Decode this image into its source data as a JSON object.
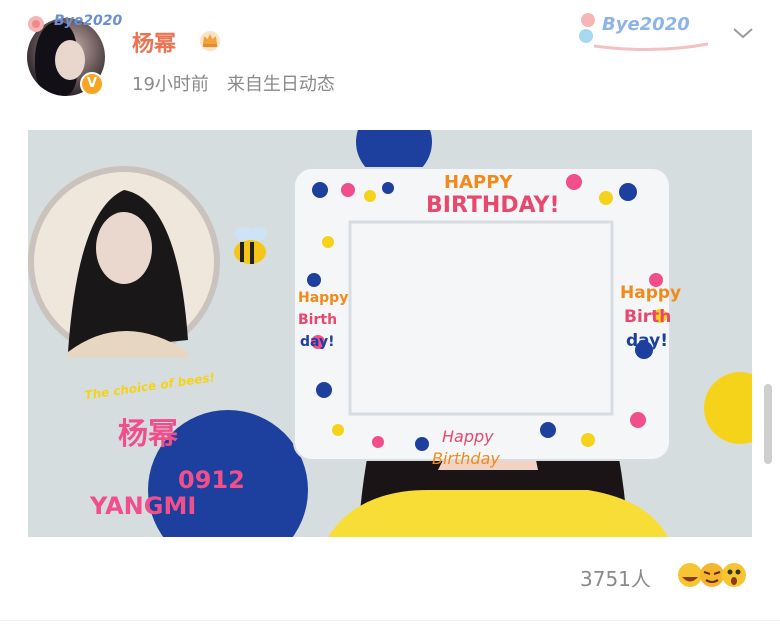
{
  "post": {
    "username": "杨幂",
    "time": "19小时前",
    "source": "来自生日动态",
    "avatar_pendant_text": "Bye2020",
    "card_text": "Bye2020"
  },
  "photo": {
    "frame_top_text_1": "HAPPY",
    "frame_top_text_2": "BIRTHDAY!",
    "frame_side_text_1": "Happy",
    "frame_side_text_2": "Birth",
    "frame_side_text_3": "day!",
    "frame_bottom_text_1": "Happy",
    "frame_bottom_text_2": "Birthday",
    "name_cn": "杨幂",
    "date": "0912",
    "name_en": "YANGMI",
    "caption": "The choice of bees!"
  },
  "footer": {
    "likes": "3751人"
  },
  "colors": {
    "username": "#eb7350",
    "verified": "#f6a623",
    "meta": "#8a8a8a",
    "accent_pink": "#f04f8c",
    "accent_blue": "#1d3f9e",
    "accent_yellow": "#f5d31a"
  }
}
